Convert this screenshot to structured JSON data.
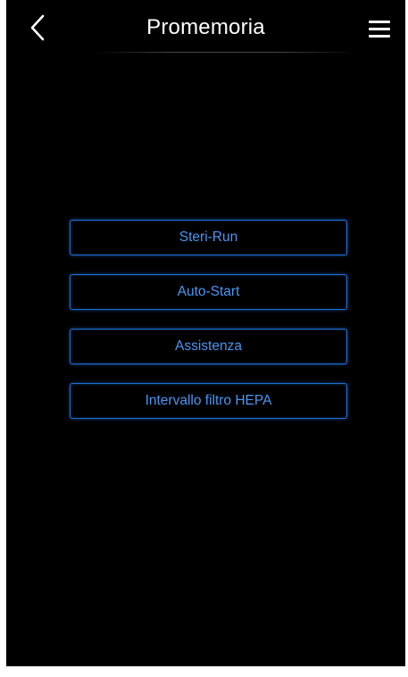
{
  "header": {
    "title": "Promemoria",
    "back_icon": "chevron-left-icon",
    "menu_icon": "hamburger-menu-icon"
  },
  "menu_items": [
    {
      "label": "Steri-Run"
    },
    {
      "label": "Auto-Start"
    },
    {
      "label": "Assistenza"
    },
    {
      "label": "Intervallo filtro HEPA"
    }
  ],
  "colors": {
    "background": "#000000",
    "title_text": "#ffffff",
    "button_border": "#1f6fd8",
    "button_text": "#4a96f2"
  }
}
